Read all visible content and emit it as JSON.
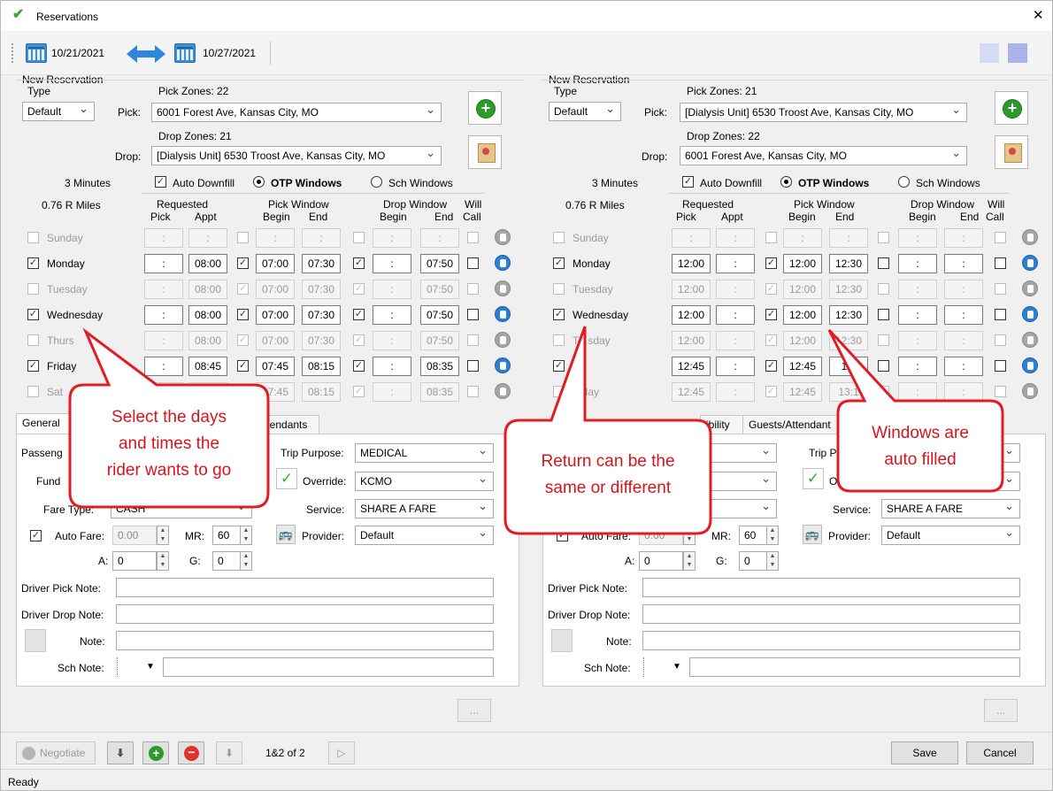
{
  "window": {
    "title": "Reservations",
    "close": "✕",
    "status": "Ready"
  },
  "toolbar": {
    "start_date": "10/21/2021",
    "end_date": "10/27/2021"
  },
  "colors": {
    "callout_red": "#e31b23",
    "accent_blue": "#2d7fd3",
    "add_green": "#2d9a2d"
  },
  "common": {
    "new_reservation": "New Reservation",
    "type_label": "Type",
    "pick_label": "Pick:",
    "drop_label": "Drop:",
    "minutes": "3 Minutes",
    "miles": "0.76 R Miles",
    "auto_downfill": "Auto Downfill",
    "otp_windows": "OTP Windows",
    "sch_windows": "Sch Windows",
    "hdr_requested": "Requested",
    "hdr_pick": "Pick",
    "hdr_appt": "Appt",
    "hdr_pick_window": "Pick Window",
    "hdr_begin": "Begin",
    "hdr_end": "End",
    "hdr_drop_window": "Drop Window",
    "hdr_will": "Will",
    "hdr_call": "Call",
    "colon": ":",
    "tab_general": "General",
    "tab_eligibility": "ibility",
    "tab_guests": "Guests/Attendant",
    "tab_attendants_left": "ttendants",
    "passenger": "Passeng",
    "funding": "Fund",
    "fare_type": "Fare Type:",
    "fare_type_value": "CASH",
    "auto_fare": "Auto Fare:",
    "auto_fare_value": "0.00",
    "mr": "MR:",
    "mr_value": "60",
    "a_label": "A:",
    "a_value": "0",
    "g_label": "G:",
    "g_value": "0",
    "trip_purpose": "Trip Purpose:",
    "trip_purpose_value": "MEDICAL",
    "trip_purpose_short": "Trip P",
    "override": "Override:",
    "override_value": "KCMO",
    "override_short": "O",
    "service": "Service:",
    "service_value": "SHARE A FARE",
    "provider": "Provider:",
    "provider_value": "Default",
    "driver_pick_note": "Driver Pick Note:",
    "driver_drop_note": "Driver Drop Note:",
    "note": "Note:",
    "sch_note": "Sch Note:",
    "more": "...",
    "checkmark": "✓"
  },
  "left": {
    "type_value": "Default",
    "pick_zones": "Pick Zones: 22",
    "pick_address": "6001 Forest Ave, Kansas City, MO",
    "drop_zones": "Drop Zones: 21",
    "drop_address": "[Dialysis Unit] 6530 Troost Ave, Kansas City, MO",
    "days": [
      {
        "name": "Sunday",
        "active": false,
        "checked": false,
        "pick": ":",
        "appt": ":",
        "pw_begin": ":",
        "pw_end": ":",
        "dw_begin": ":",
        "dw_end": ":"
      },
      {
        "name": "Monday",
        "active": true,
        "checked": true,
        "pick": ":",
        "appt": "08:00",
        "pw_begin": "07:00",
        "pw_end": "07:30",
        "dw_begin": ":",
        "dw_end": "07:50"
      },
      {
        "name": "Tuesday",
        "active": false,
        "checked": false,
        "pick": ":",
        "appt": "08:00",
        "pw_begin": "07:00",
        "pw_end": "07:30",
        "dw_begin": ":",
        "dw_end": "07:50"
      },
      {
        "name": "Wednesday",
        "active": true,
        "checked": true,
        "pick": ":",
        "appt": "08:00",
        "pw_begin": "07:00",
        "pw_end": "07:30",
        "dw_begin": ":",
        "dw_end": "07:50"
      },
      {
        "name": "Thurs",
        "active": false,
        "checked": false,
        "pick": ":",
        "appt": "08:00",
        "pw_begin": "07:00",
        "pw_end": "07:30",
        "dw_begin": ":",
        "dw_end": "07:50"
      },
      {
        "name": "Friday",
        "active": true,
        "checked": true,
        "pick": ":",
        "appt": "08:45",
        "pw_begin": "07:45",
        "pw_end": "08:15",
        "dw_begin": ":",
        "dw_end": "08:35"
      },
      {
        "name": "Sat",
        "active": false,
        "checked": false,
        "pick": ":",
        "appt": "08:45",
        "pw_begin": "07:45",
        "pw_end": "08:15",
        "dw_begin": ":",
        "dw_end": "08:35"
      }
    ]
  },
  "right": {
    "type_value": "Default",
    "pick_zones": "Pick Zones: 21",
    "pick_address": "[Dialysis Unit] 6530 Troost Ave, Kansas City, MO",
    "drop_zones": "Drop Zones: 22",
    "drop_address": "6001 Forest Ave, Kansas City, MO",
    "days": [
      {
        "name": "Sunday",
        "active": false,
        "checked": false,
        "pick": ":",
        "appt": ":",
        "pw_begin": ":",
        "pw_end": ":",
        "dw_begin": ":",
        "dw_end": ":"
      },
      {
        "name": "Monday",
        "active": true,
        "checked": true,
        "pick": "12:00",
        "appt": ":",
        "pw_begin": "12:00",
        "pw_end": "12:30",
        "dw_begin": ":",
        "dw_end": ":"
      },
      {
        "name": "Tuesday",
        "active": false,
        "checked": false,
        "pick": "12:00",
        "appt": ":",
        "pw_begin": "12:00",
        "pw_end": "12:30",
        "dw_begin": ":",
        "dw_end": ":"
      },
      {
        "name": "Wednesday",
        "active": true,
        "checked": true,
        "pick": "12:00",
        "appt": ":",
        "pw_begin": "12:00",
        "pw_end": "12:30",
        "dw_begin": ":",
        "dw_end": ":"
      },
      {
        "name": "Th  sday",
        "active": false,
        "checked": false,
        "pick": "12:00",
        "appt": ":",
        "pw_begin": "12:00",
        "pw_end": "12:30",
        "dw_begin": ":",
        "dw_end": ":"
      },
      {
        "name": "   lay",
        "active": true,
        "checked": true,
        "pick": "12:45",
        "appt": ":",
        "pw_begin": "12:45",
        "pw_end": "13:",
        "dw_begin": ":",
        "dw_end": ":"
      },
      {
        "name": "  urday",
        "active": false,
        "checked": false,
        "pick": "12:45",
        "appt": ":",
        "pw_begin": "12:45",
        "pw_end": "13:1",
        "dw_begin": ":",
        "dw_end": ":"
      }
    ]
  },
  "bottom": {
    "negotiate": "Negotiate",
    "pager": "1&2 of 2",
    "save": "Save",
    "cancel": "Cancel"
  },
  "callouts": [
    {
      "lines": [
        "Select the days",
        "and times the",
        "rider wants to go"
      ]
    },
    {
      "lines": [
        "Return can be the",
        "same or different"
      ]
    },
    {
      "lines": [
        "Windows are",
        "auto filled"
      ]
    }
  ]
}
